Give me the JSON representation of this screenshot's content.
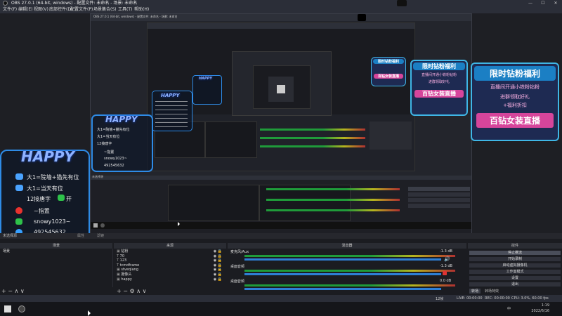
{
  "window": {
    "title": "OBS 27.0.1 (64-bit, windows) - 配置文件: 未命名 - 场景: 未命名",
    "controls": [
      "—",
      "☐",
      "✕"
    ]
  },
  "menu": [
    "文件(F)",
    "编辑(E)",
    "视图(V)",
    "底部控件(D)",
    "配置文件(P)",
    "场景集合(S)",
    "工具(T)",
    "帮助(H)"
  ],
  "overlay": {
    "happy": "HAPPY",
    "lines": [
      "大1=院墙+猫先有位",
      "大1=当天有位",
      "12接唐字",
      "开",
      "~指置",
      "snowy1023~",
      "492545632"
    ],
    "promo_small": {
      "top": "限时钻粉福利",
      "mid": "直播间开通小铁粉钻粉",
      "sub": "进群领取好礼",
      "sub2": "+福利折扣",
      "big": "百钻女装直播"
    }
  },
  "docks": {
    "toolbar": {
      "no_source": "未选择源",
      "props": "属性",
      "filters": "滤镜"
    },
    "scenes_title": "场景",
    "scenes": [
      "场景"
    ],
    "sources_title": "来源",
    "sources": [
      "钻粉",
      "70",
      "123",
      "tcmdframe",
      "stveqlang",
      "摄像头",
      "happy"
    ],
    "mixer_title": "混音器",
    "mixer": [
      {
        "name": "麦克风/Aux",
        "db": "-1.3 dB"
      },
      {
        "name": "桌面音频",
        "db": "-1.3 dB"
      },
      {
        "name": "桌面音频",
        "db": "0.0 dB"
      }
    ],
    "controls_title": "控件",
    "controls": [
      "停止推流",
      "开始录制",
      "启动虚拟摄像机",
      "工作室模式",
      "设置",
      "退出"
    ],
    "tabs": [
      "转场",
      "转场特效"
    ]
  },
  "status": {
    "live": "LIVE: 00:00:00",
    "rec": "REC: 00:00:00",
    "cpu": "CPU: 3.0%, 60.00 fps",
    "dropped": "12帧",
    "kb": "kb/s: 2473"
  },
  "taskbar": {
    "time": "1:19",
    "date": "2022/6/16",
    "lang": "中"
  },
  "colors": {
    "accent": "#2e8be6",
    "green": "#1f9b3a",
    "pink": "#d6459b"
  }
}
